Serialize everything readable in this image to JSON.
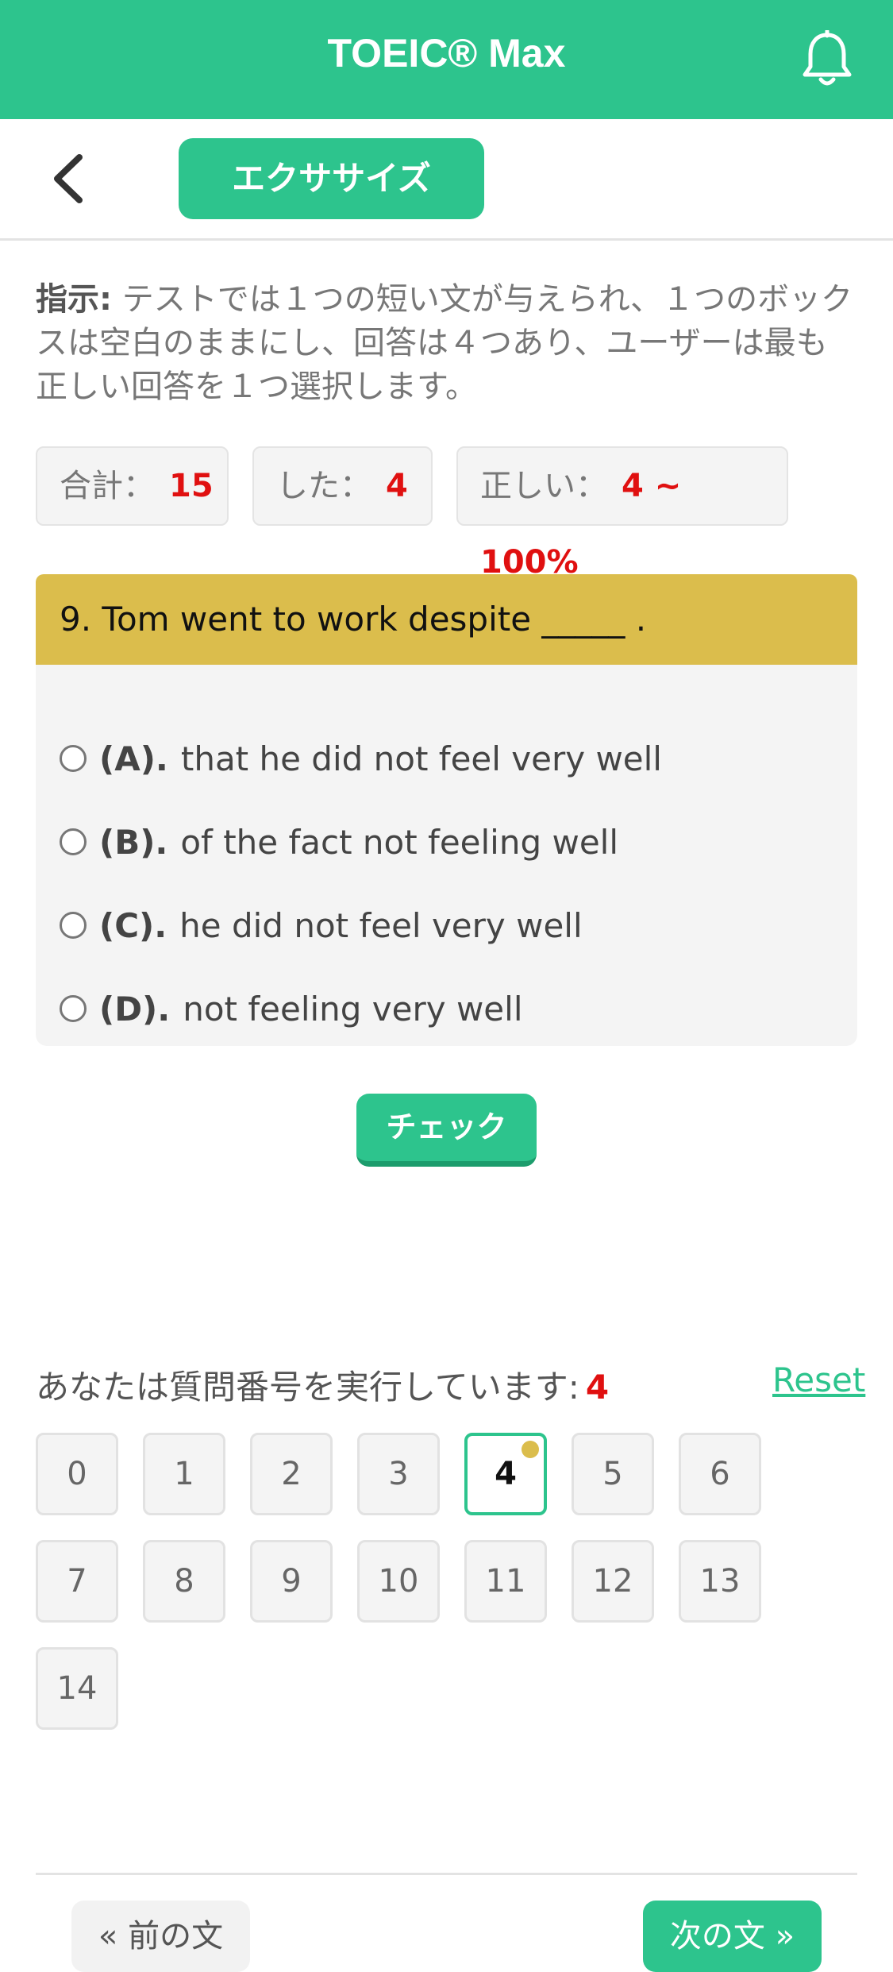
{
  "app": {
    "title": "TOEIC® Max",
    "bell_icon": "bell-icon",
    "back_icon": "chevron-left-icon",
    "exercise_label": "エクササイズ"
  },
  "instruction": {
    "label": "指示:",
    "text": "テストでは１つの短い文が与えられ、１つのボックスは空白のままにし、回答は４つあり、ユーザーは最も正しい回答を１つ選択します。"
  },
  "stats": {
    "total_label": "合計：",
    "total_value": "15",
    "done_label": "した：",
    "done_value": "4",
    "correct_label": "正しい：",
    "correct_value": "4 ~ 100%"
  },
  "question": {
    "text": "9. Tom went to work despite _____ .",
    "options": [
      {
        "letter": "(A).",
        "text": "that he did not feel very well"
      },
      {
        "letter": "(B).",
        "text": "of the fact not feeling well"
      },
      {
        "letter": "(C).",
        "text": "he did not feel very well"
      },
      {
        "letter": "(D).",
        "text": "not feeling very well"
      }
    ]
  },
  "check_label": "チェック",
  "progress": {
    "label": "あなたは質問番号を実行しています:",
    "current": "4",
    "reset_label": "Reset",
    "numbers": [
      "0",
      "1",
      "2",
      "3",
      "4",
      "5",
      "6",
      "7",
      "8",
      "9",
      "10",
      "11",
      "12",
      "13",
      "14"
    ]
  },
  "nav": {
    "prev_label": "« 前の文",
    "next_label": "次の文 »"
  },
  "colors": {
    "brand": "#2dc48d",
    "question_header": "#dbbd4c",
    "highlight_red": "#e01010"
  }
}
